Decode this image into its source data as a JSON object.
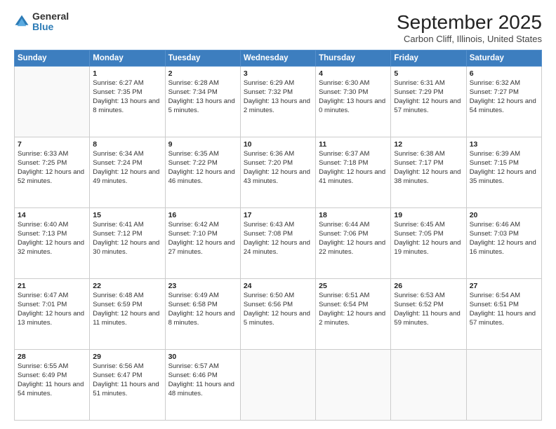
{
  "logo": {
    "general": "General",
    "blue": "Blue"
  },
  "title": "September 2025",
  "subtitle": "Carbon Cliff, Illinois, United States",
  "headers": [
    "Sunday",
    "Monday",
    "Tuesday",
    "Wednesday",
    "Thursday",
    "Friday",
    "Saturday"
  ],
  "weeks": [
    [
      {
        "day": "",
        "sunrise": "",
        "sunset": "",
        "daylight": ""
      },
      {
        "day": "1",
        "sunrise": "Sunrise: 6:27 AM",
        "sunset": "Sunset: 7:35 PM",
        "daylight": "Daylight: 13 hours and 8 minutes."
      },
      {
        "day": "2",
        "sunrise": "Sunrise: 6:28 AM",
        "sunset": "Sunset: 7:34 PM",
        "daylight": "Daylight: 13 hours and 5 minutes."
      },
      {
        "day": "3",
        "sunrise": "Sunrise: 6:29 AM",
        "sunset": "Sunset: 7:32 PM",
        "daylight": "Daylight: 13 hours and 2 minutes."
      },
      {
        "day": "4",
        "sunrise": "Sunrise: 6:30 AM",
        "sunset": "Sunset: 7:30 PM",
        "daylight": "Daylight: 13 hours and 0 minutes."
      },
      {
        "day": "5",
        "sunrise": "Sunrise: 6:31 AM",
        "sunset": "Sunset: 7:29 PM",
        "daylight": "Daylight: 12 hours and 57 minutes."
      },
      {
        "day": "6",
        "sunrise": "Sunrise: 6:32 AM",
        "sunset": "Sunset: 7:27 PM",
        "daylight": "Daylight: 12 hours and 54 minutes."
      }
    ],
    [
      {
        "day": "7",
        "sunrise": "Sunrise: 6:33 AM",
        "sunset": "Sunset: 7:25 PM",
        "daylight": "Daylight: 12 hours and 52 minutes."
      },
      {
        "day": "8",
        "sunrise": "Sunrise: 6:34 AM",
        "sunset": "Sunset: 7:24 PM",
        "daylight": "Daylight: 12 hours and 49 minutes."
      },
      {
        "day": "9",
        "sunrise": "Sunrise: 6:35 AM",
        "sunset": "Sunset: 7:22 PM",
        "daylight": "Daylight: 12 hours and 46 minutes."
      },
      {
        "day": "10",
        "sunrise": "Sunrise: 6:36 AM",
        "sunset": "Sunset: 7:20 PM",
        "daylight": "Daylight: 12 hours and 43 minutes."
      },
      {
        "day": "11",
        "sunrise": "Sunrise: 6:37 AM",
        "sunset": "Sunset: 7:18 PM",
        "daylight": "Daylight: 12 hours and 41 minutes."
      },
      {
        "day": "12",
        "sunrise": "Sunrise: 6:38 AM",
        "sunset": "Sunset: 7:17 PM",
        "daylight": "Daylight: 12 hours and 38 minutes."
      },
      {
        "day": "13",
        "sunrise": "Sunrise: 6:39 AM",
        "sunset": "Sunset: 7:15 PM",
        "daylight": "Daylight: 12 hours and 35 minutes."
      }
    ],
    [
      {
        "day": "14",
        "sunrise": "Sunrise: 6:40 AM",
        "sunset": "Sunset: 7:13 PM",
        "daylight": "Daylight: 12 hours and 32 minutes."
      },
      {
        "day": "15",
        "sunrise": "Sunrise: 6:41 AM",
        "sunset": "Sunset: 7:12 PM",
        "daylight": "Daylight: 12 hours and 30 minutes."
      },
      {
        "day": "16",
        "sunrise": "Sunrise: 6:42 AM",
        "sunset": "Sunset: 7:10 PM",
        "daylight": "Daylight: 12 hours and 27 minutes."
      },
      {
        "day": "17",
        "sunrise": "Sunrise: 6:43 AM",
        "sunset": "Sunset: 7:08 PM",
        "daylight": "Daylight: 12 hours and 24 minutes."
      },
      {
        "day": "18",
        "sunrise": "Sunrise: 6:44 AM",
        "sunset": "Sunset: 7:06 PM",
        "daylight": "Daylight: 12 hours and 22 minutes."
      },
      {
        "day": "19",
        "sunrise": "Sunrise: 6:45 AM",
        "sunset": "Sunset: 7:05 PM",
        "daylight": "Daylight: 12 hours and 19 minutes."
      },
      {
        "day": "20",
        "sunrise": "Sunrise: 6:46 AM",
        "sunset": "Sunset: 7:03 PM",
        "daylight": "Daylight: 12 hours and 16 minutes."
      }
    ],
    [
      {
        "day": "21",
        "sunrise": "Sunrise: 6:47 AM",
        "sunset": "Sunset: 7:01 PM",
        "daylight": "Daylight: 12 hours and 13 minutes."
      },
      {
        "day": "22",
        "sunrise": "Sunrise: 6:48 AM",
        "sunset": "Sunset: 6:59 PM",
        "daylight": "Daylight: 12 hours and 11 minutes."
      },
      {
        "day": "23",
        "sunrise": "Sunrise: 6:49 AM",
        "sunset": "Sunset: 6:58 PM",
        "daylight": "Daylight: 12 hours and 8 minutes."
      },
      {
        "day": "24",
        "sunrise": "Sunrise: 6:50 AM",
        "sunset": "Sunset: 6:56 PM",
        "daylight": "Daylight: 12 hours and 5 minutes."
      },
      {
        "day": "25",
        "sunrise": "Sunrise: 6:51 AM",
        "sunset": "Sunset: 6:54 PM",
        "daylight": "Daylight: 12 hours and 2 minutes."
      },
      {
        "day": "26",
        "sunrise": "Sunrise: 6:53 AM",
        "sunset": "Sunset: 6:52 PM",
        "daylight": "Daylight: 11 hours and 59 minutes."
      },
      {
        "day": "27",
        "sunrise": "Sunrise: 6:54 AM",
        "sunset": "Sunset: 6:51 PM",
        "daylight": "Daylight: 11 hours and 57 minutes."
      }
    ],
    [
      {
        "day": "28",
        "sunrise": "Sunrise: 6:55 AM",
        "sunset": "Sunset: 6:49 PM",
        "daylight": "Daylight: 11 hours and 54 minutes."
      },
      {
        "day": "29",
        "sunrise": "Sunrise: 6:56 AM",
        "sunset": "Sunset: 6:47 PM",
        "daylight": "Daylight: 11 hours and 51 minutes."
      },
      {
        "day": "30",
        "sunrise": "Sunrise: 6:57 AM",
        "sunset": "Sunset: 6:46 PM",
        "daylight": "Daylight: 11 hours and 48 minutes."
      },
      {
        "day": "",
        "sunrise": "",
        "sunset": "",
        "daylight": ""
      },
      {
        "day": "",
        "sunrise": "",
        "sunset": "",
        "daylight": ""
      },
      {
        "day": "",
        "sunrise": "",
        "sunset": "",
        "daylight": ""
      },
      {
        "day": "",
        "sunrise": "",
        "sunset": "",
        "daylight": ""
      }
    ]
  ]
}
